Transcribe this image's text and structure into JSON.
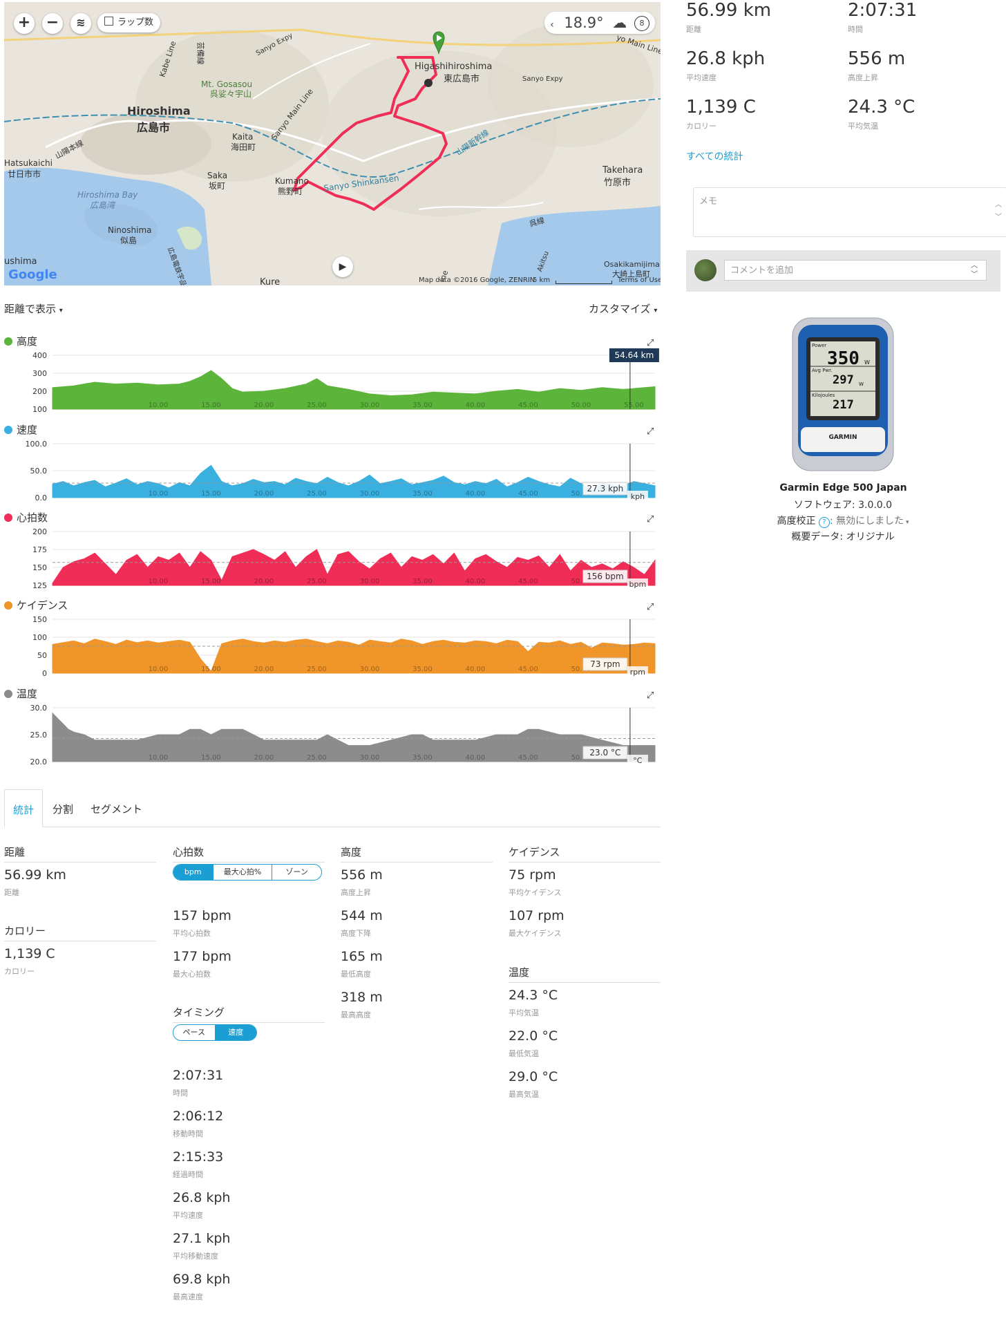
{
  "map": {
    "lap_label": "ラップ数",
    "temp": "18.9°",
    "play": "▶",
    "labels": {
      "hiroshima": "Hiroshima",
      "hiroshima_jp": "広島市",
      "gosasou": "Mt. Gosasou",
      "gosasou_jp": "呉娑々宇山",
      "kaita": "Kaita",
      "kaita_jp": "海田町",
      "hatsukaichi": "Hatsukaichi",
      "hatsukaichi_jp": "廿日市市",
      "saka": "Saka",
      "saka_jp": "坂町",
      "kumano": "Kumano",
      "kumano_jp": "熊野町",
      "higashihiroshima": "Higashihiroshima",
      "higashihiroshima_jp": "東広島市",
      "takehara": "Takehara",
      "takehara_jp": "竹原市",
      "hiroshima_bay": "Hiroshima Bay",
      "hiroshima_bay_jp": "広島湾",
      "ninoshima": "Ninoshima",
      "ninoshima_jp": "似島",
      "sanyo_shinkansen": "Sanyo Shinkansen",
      "sanyo_shinkansen_jp": "山陽新幹線",
      "sanyo_expy": "Sanyo Expy",
      "sanyo_main": "Sanyo Main Line",
      "osakikamijima": "Osakikamijima",
      "osakikamijima_jp": "大崎上島町",
      "kure": "Kure",
      "ushima": "ushima",
      "kabe_line": "Kabe Line",
      "sanyo_line_jp": "山陽本線",
      "kure_line_jp": "呉線",
      "geibi_jp": "芸備線",
      "hiroden_jp": "広島電鉄宇品線",
      "akitsu": "Akitsu",
      "ine": "ine",
      "google": "Google",
      "attribution": "Map data ©2016 Google, ZENRIN",
      "scale": "5 km",
      "terms": "Terms of Use",
      "sanyo_expy_right": "Sanyo Expy",
      "main_line_right": "yo Main Line"
    }
  },
  "summary": [
    {
      "value": "56.99 km",
      "label": "距離"
    },
    {
      "value": "2:07:31",
      "label": "時間"
    },
    {
      "value": "26.8 kph",
      "label": "平均速度"
    },
    {
      "value": "556 m",
      "label": "高度上昇"
    },
    {
      "value": "1,139 C",
      "label": "カロリー"
    },
    {
      "value": "24.3 °C",
      "label": "平均気温"
    }
  ],
  "all_stats_link": "すべての統計",
  "memo_placeholder": "メモ",
  "comment_placeholder": "コメントを追加",
  "device": {
    "name": "Garmin Edge 500 Japan",
    "software": "ソフトウェア: 3.0.0.0",
    "elevation": "高度校正",
    "elevation_value": ": 無効にしました",
    "summary_data": "概要データ: オリジナル",
    "screen": {
      "power_label": "Power",
      "power": "350",
      "power_unit": "W",
      "avg_label": "Avg Pwr.",
      "avg": "297",
      "avg_unit": "W",
      "kj_label": "Kilojoules",
      "kj": "217",
      "brand": "GARMIN"
    }
  },
  "chart_toolbar": {
    "view": "距離で表示",
    "customize": "カスタマイズ"
  },
  "colors": {
    "elevation": "#5db43a",
    "speed": "#3ab0e0",
    "hr": "#ef2d56",
    "cadence": "#f0952a",
    "temp": "#8c8c8c",
    "accent": "#1a9ed3"
  },
  "chart_data": [
    {
      "type": "area",
      "title": "高度",
      "color": "#5db43a",
      "ylim": [
        100,
        400
      ],
      "yticks": [
        "400",
        "300",
        "200",
        "100"
      ],
      "xlim": [
        0,
        57
      ],
      "xticks": [
        "10.00",
        "15.00",
        "20.00",
        "25.00",
        "30.00",
        "35.00",
        "40.00",
        "45.00",
        "50.00",
        "55.00"
      ],
      "cursor_label": "54.64 km",
      "cursor_x": 54.64,
      "x": [
        0,
        2,
        4,
        6,
        8,
        10,
        12,
        13,
        14,
        15,
        16,
        17,
        18,
        20,
        22,
        24,
        25,
        26,
        28,
        30,
        32,
        34,
        36,
        38,
        40,
        42,
        44,
        46,
        48,
        50,
        52,
        54,
        55,
        56,
        57
      ],
      "y": [
        220,
        230,
        250,
        240,
        245,
        235,
        240,
        255,
        280,
        315,
        270,
        215,
        195,
        200,
        215,
        240,
        270,
        230,
        210,
        185,
        175,
        180,
        195,
        190,
        185,
        200,
        210,
        195,
        215,
        205,
        220,
        210,
        215,
        220,
        225
      ]
    },
    {
      "type": "area",
      "title": "速度",
      "color": "#3ab0e0",
      "ylim": [
        0,
        100
      ],
      "yticks": [
        "100.0",
        "50.0",
        "0.0"
      ],
      "xlim": [
        0,
        57
      ],
      "xticks": [
        "10.00",
        "15.00",
        "20.00",
        "25.00",
        "30.00",
        "35.00",
        "40.00",
        "45.00",
        "50.00",
        "55.00"
      ],
      "cursor_label": "27.3 kph",
      "unit_tail": "kph",
      "cursor_x": 54.64,
      "ref": 27,
      "x": [
        0,
        1,
        2,
        3,
        4,
        5,
        6,
        7,
        8,
        9,
        10,
        11,
        12,
        13,
        14,
        15,
        16,
        17,
        18,
        19,
        20,
        21,
        22,
        23,
        24,
        25,
        26,
        27,
        28,
        29,
        30,
        31,
        32,
        33,
        34,
        35,
        36,
        37,
        38,
        39,
        40,
        41,
        42,
        43,
        44,
        45,
        46,
        47,
        48,
        49,
        50,
        51,
        52,
        53,
        54,
        55,
        56,
        57
      ],
      "y": [
        25,
        30,
        22,
        28,
        32,
        20,
        27,
        35,
        24,
        30,
        26,
        18,
        28,
        22,
        45,
        60,
        30,
        22,
        26,
        34,
        28,
        30,
        24,
        36,
        30,
        26,
        38,
        28,
        22,
        30,
        42,
        26,
        30,
        35,
        24,
        28,
        32,
        40,
        28,
        24,
        30,
        26,
        34,
        20,
        28,
        38,
        30,
        24,
        20,
        36,
        26,
        14,
        28,
        24,
        22,
        30,
        26,
        22
      ]
    },
    {
      "type": "area",
      "title": "心拍数",
      "color": "#ef2d56",
      "ylim": [
        125,
        200
      ],
      "yticks": [
        "200",
        "175",
        "150",
        "125"
      ],
      "xlim": [
        0,
        57
      ],
      "xticks": [
        "10.00",
        "15.00",
        "20.00",
        "25.00",
        "30.00",
        "35.00",
        "40.00",
        "45.00",
        "50.00",
        "55.00"
      ],
      "cursor_label": "156 bpm",
      "unit_tail": "bpm",
      "cursor_x": 54.64,
      "ref": 157,
      "x": [
        0,
        1,
        2,
        3,
        4,
        5,
        6,
        7,
        8,
        9,
        10,
        11,
        12,
        13,
        14,
        15,
        16,
        17,
        18,
        19,
        20,
        21,
        22,
        23,
        24,
        25,
        26,
        27,
        28,
        29,
        30,
        31,
        32,
        33,
        34,
        35,
        36,
        37,
        38,
        39,
        40,
        41,
        42,
        43,
        44,
        45,
        46,
        47,
        48,
        49,
        50,
        51,
        52,
        53,
        54,
        55,
        56,
        57
      ],
      "y": [
        128,
        150,
        158,
        162,
        170,
        155,
        140,
        160,
        168,
        150,
        165,
        160,
        170,
        150,
        172,
        160,
        132,
        165,
        170,
        175,
        168,
        160,
        172,
        150,
        165,
        175,
        140,
        168,
        172,
        158,
        148,
        162,
        170,
        150,
        165,
        160,
        168,
        155,
        170,
        145,
        162,
        168,
        158,
        150,
        164,
        160,
        166,
        150,
        168,
        145,
        160,
        150,
        155,
        148,
        158,
        150,
        140,
        160
      ]
    },
    {
      "type": "area",
      "title": "ケイデンス",
      "color": "#f0952a",
      "ylim": [
        0,
        150
      ],
      "yticks": [
        "150",
        "100",
        "50",
        "0"
      ],
      "xlim": [
        0,
        57
      ],
      "xticks": [
        "10.00",
        "15.00",
        "20.00",
        "25.00",
        "30.00",
        "35.00",
        "40.00",
        "45.00",
        "50.00",
        "55.00"
      ],
      "cursor_label": "73 rpm",
      "unit_tail": "rpm",
      "cursor_x": 54.64,
      "ref": 75,
      "x": [
        0,
        1,
        2,
        3,
        4,
        5,
        6,
        7,
        8,
        9,
        10,
        11,
        12,
        13,
        14,
        15,
        16,
        17,
        18,
        19,
        20,
        21,
        22,
        23,
        24,
        25,
        26,
        27,
        28,
        29,
        30,
        31,
        32,
        33,
        34,
        35,
        36,
        37,
        38,
        39,
        40,
        41,
        42,
        43,
        44,
        45,
        46,
        47,
        48,
        49,
        50,
        51,
        52,
        53,
        54,
        55,
        56,
        57
      ],
      "y": [
        80,
        85,
        90,
        82,
        95,
        88,
        80,
        92,
        85,
        90,
        84,
        88,
        92,
        86,
        40,
        5,
        82,
        90,
        95,
        88,
        84,
        90,
        86,
        92,
        95,
        88,
        82,
        90,
        86,
        78,
        92,
        88,
        84,
        95,
        90,
        80,
        88,
        92,
        86,
        84,
        90,
        88,
        82,
        92,
        88,
        60,
        86,
        84,
        90,
        80,
        86,
        70,
        84,
        82,
        78,
        80,
        84,
        82
      ]
    },
    {
      "type": "area",
      "title": "温度",
      "color": "#8c8c8c",
      "ylim": [
        20,
        30
      ],
      "yticks": [
        "30.0",
        "25.0",
        "20.0"
      ],
      "xlim": [
        0,
        57
      ],
      "xticks": [
        "10.00",
        "15.00",
        "20.00",
        "25.00",
        "30.00",
        "35.00",
        "40.00",
        "45.00",
        "50.00",
        "55.00"
      ],
      "cursor_label": "23.0 °C",
      "unit_tail": "°C",
      "cursor_x": 54.64,
      "ref": 24.3,
      "x": [
        0,
        0.5,
        1,
        1.5,
        2,
        3,
        4,
        6,
        8,
        10,
        12,
        13,
        14,
        15,
        16,
        18,
        19,
        20,
        22,
        24,
        25,
        26,
        27,
        28,
        30,
        32,
        34,
        35,
        36,
        38,
        40,
        42,
        44,
        45,
        46,
        48,
        50,
        52,
        54,
        55,
        57
      ],
      "y": [
        29,
        28,
        27,
        26,
        25.5,
        25,
        24,
        24,
        24,
        25,
        25,
        26,
        26,
        25,
        26,
        26,
        25,
        24,
        24,
        24,
        24,
        25,
        24,
        23,
        23,
        24,
        25,
        25,
        24,
        24,
        24,
        25,
        25,
        26,
        26,
        25,
        25,
        24,
        23,
        23,
        23
      ]
    }
  ],
  "stats": {
    "tabs": [
      "統計",
      "分割",
      "セグメント"
    ],
    "distance": {
      "header": "距離",
      "value": "56.99 km",
      "label": "距離"
    },
    "calories": {
      "header": "カロリー",
      "value": "1,139 C",
      "label": "カロリー"
    },
    "hr": {
      "header": "心拍数",
      "toggle": [
        "bpm",
        "最大心拍%",
        "ゾーン"
      ],
      "items": [
        {
          "value": "157 bpm",
          "label": "平均心拍数"
        },
        {
          "value": "177 bpm",
          "label": "最大心拍数"
        }
      ]
    },
    "timing": {
      "header": "タイミング",
      "toggle": [
        "ペース",
        "速度"
      ],
      "items": [
        {
          "value": "2:07:31",
          "label": "時間"
        },
        {
          "value": "2:06:12",
          "label": "移動時間"
        },
        {
          "value": "2:15:33",
          "label": "経過時間"
        },
        {
          "value": "26.8 kph",
          "label": "平均速度"
        },
        {
          "value": "27.1 kph",
          "label": "平均移動速度"
        },
        {
          "value": "69.8 kph",
          "label": "最高速度"
        }
      ]
    },
    "elevation": {
      "header": "高度",
      "items": [
        {
          "value": "556 m",
          "label": "高度上昇"
        },
        {
          "value": "544 m",
          "label": "高度下降"
        },
        {
          "value": "165 m",
          "label": "最低高度"
        },
        {
          "value": "318 m",
          "label": "最高高度"
        }
      ]
    },
    "cadence": {
      "header": "ケイデンス",
      "items": [
        {
          "value": "75 rpm",
          "label": "平均ケイデンス"
        },
        {
          "value": "107 rpm",
          "label": "最大ケイデンス"
        }
      ]
    },
    "temperature": {
      "header": "温度",
      "items": [
        {
          "value": "24.3 °C",
          "label": "平均気温"
        },
        {
          "value": "22.0 °C",
          "label": "最低気温"
        },
        {
          "value": "29.0 °C",
          "label": "最高気温"
        }
      ]
    }
  }
}
